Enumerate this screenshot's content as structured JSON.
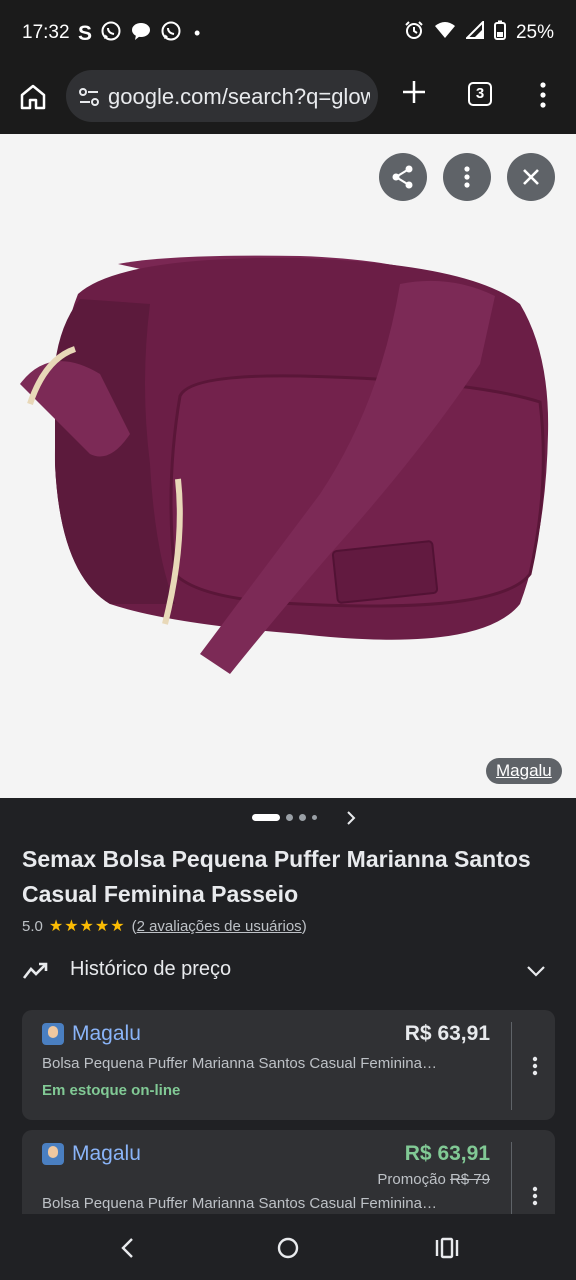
{
  "status_bar": {
    "time": "17:32",
    "apps": [
      "S",
      "whatsapp-icon",
      "chat-icon",
      "whatsapp-icon",
      "•"
    ],
    "battery": "25%"
  },
  "browser": {
    "url": "google.com/search?q=glow",
    "tab_count": "3"
  },
  "image": {
    "source_tag": "Magalu",
    "product_color": "#6b1e46",
    "carousel_count": 4,
    "carousel_active": 0
  },
  "product": {
    "title": "Semax Bolsa Pequena Puffer Marianna Santos Casual Feminina Passeio",
    "rating": "5.0",
    "stars": "★★★★★",
    "reviews": "2 avaliações de usuários",
    "reviews_open": "(",
    "reviews_close": ")"
  },
  "price_history": {
    "label": "Histórico de preço"
  },
  "offers": [
    {
      "store": "Magalu",
      "price": "R$ 63,91",
      "price_color": "#e8eaed",
      "description": "Bolsa Pequena Puffer Marianna Santos Casual Feminina…",
      "stock": "Em estoque on-line"
    },
    {
      "store": "Magalu",
      "price": "R$ 63,91",
      "price_color": "#81c995",
      "promo_label": "Promoção",
      "promo_old_price": "R$ 79",
      "description": "Bolsa Pequena Puffer Marianna Santos Casual Feminina…"
    }
  ]
}
